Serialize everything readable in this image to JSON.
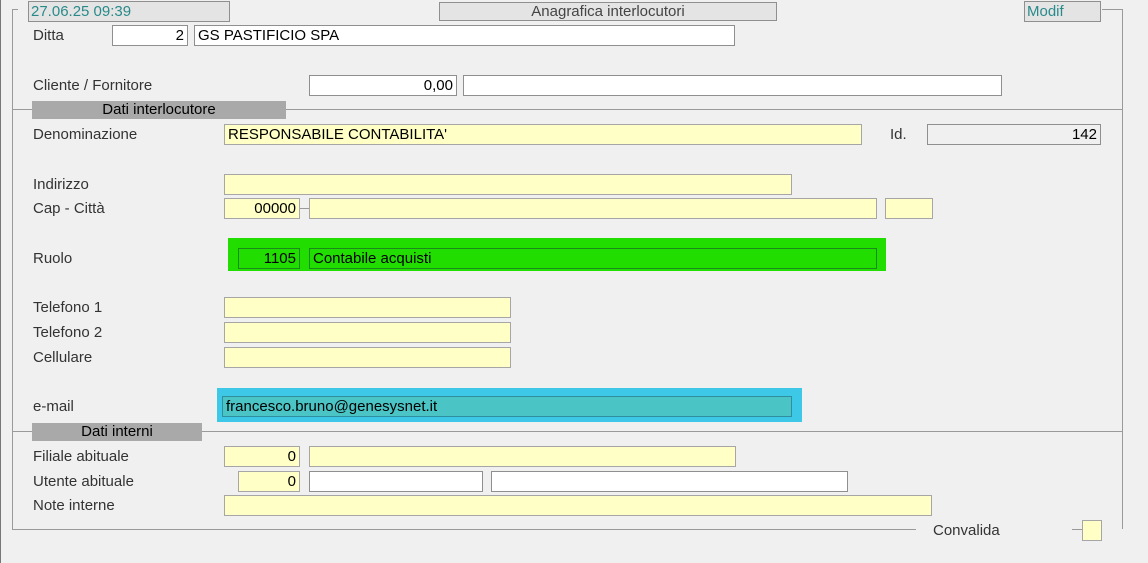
{
  "header": {
    "datetime": "27.06.25 09:39",
    "title": "Anagrafica interlocutori",
    "mode": "Modif"
  },
  "ditta": {
    "label": "Ditta",
    "code": "2",
    "name": "GS PASTIFICIO SPA"
  },
  "cliente": {
    "label": "Cliente / Fornitore",
    "code": "0,00",
    "name": ""
  },
  "sections": {
    "interlocutore": "Dati interlocutore",
    "interni": "Dati interni"
  },
  "denominazione": {
    "label": "Denominazione",
    "value": "RESPONSABILE CONTABILITA'",
    "id_label": "Id.",
    "id_value": "142"
  },
  "indirizzo": {
    "label": "Indirizzo",
    "value": ""
  },
  "cap_citta": {
    "label": "Cap - Città",
    "cap": "00000",
    "citta": "",
    "prov": ""
  },
  "ruolo": {
    "label": "Ruolo",
    "code": "1105",
    "desc": "Contabile acquisti",
    "highlight": "#22dd00"
  },
  "telefono1": {
    "label": "Telefono 1",
    "value": ""
  },
  "telefono2": {
    "label": "Telefono 2",
    "value": ""
  },
  "cellulare": {
    "label": "Cellulare",
    "value": ""
  },
  "email": {
    "label": "e-mail",
    "value": "francesco.bruno@genesysnet.it",
    "highlight": "#3ec8e8"
  },
  "filiale": {
    "label": "Filiale abituale",
    "code": "0",
    "desc": ""
  },
  "utente": {
    "label": "Utente  abituale",
    "code": "0",
    "desc1": "",
    "desc2": ""
  },
  "note": {
    "label": "Note  interne",
    "value": ""
  },
  "convalida": {
    "label": "Convalida",
    "value": ""
  },
  "colors": {
    "field_yellow": "#ffffc6",
    "section_gray": "#a9a9a9",
    "teal_text": "#2a8a8a"
  }
}
